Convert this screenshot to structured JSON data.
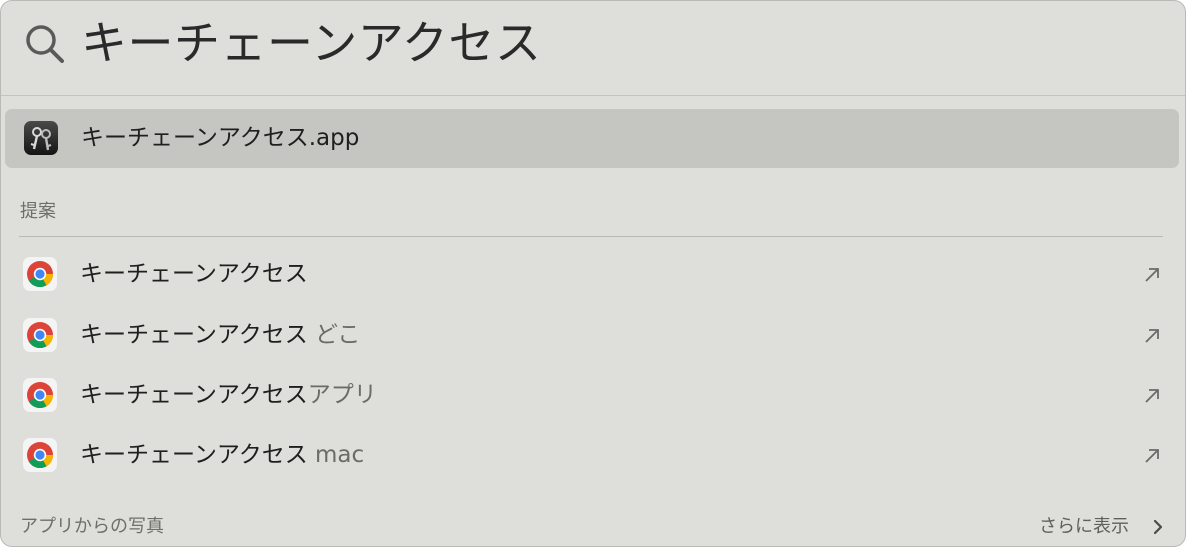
{
  "search": {
    "query": "キーチェーンアクセス"
  },
  "top_hit": {
    "label": "キーチェーンアクセス.app",
    "icon": "keychain-access-icon"
  },
  "sections": {
    "suggestions_title": "提案",
    "photos_title": "アプリからの写真",
    "show_more": "さらに表示"
  },
  "suggestions": [
    {
      "prefix": "キーチェーンアクセス",
      "suffix": "",
      "icon": "chrome-icon"
    },
    {
      "prefix": "キーチェーンアクセス",
      "suffix": " どこ",
      "icon": "chrome-icon"
    },
    {
      "prefix": "キーチェーンアクセス",
      "suffix": "アプリ",
      "icon": "chrome-icon"
    },
    {
      "prefix": "キーチェーンアクセス",
      "suffix": " mac",
      "icon": "chrome-icon"
    }
  ],
  "colors": {
    "panel_bg": "#dedfda",
    "selected_bg": "#c5c6c1",
    "text": "#1f1f1f",
    "secondary_text": "#6b6b68"
  }
}
